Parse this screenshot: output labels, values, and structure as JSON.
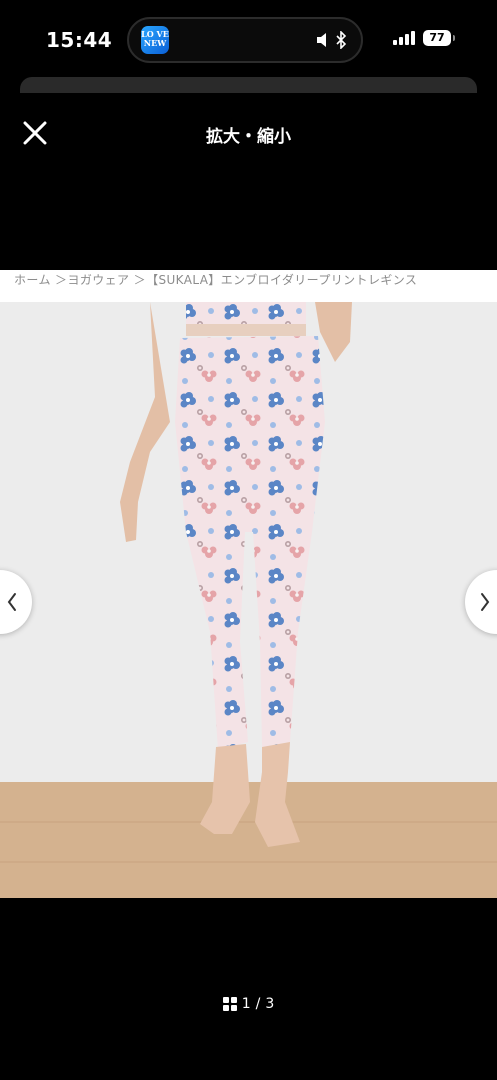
{
  "status_bar": {
    "time": "15:44",
    "app_icon_text": "LOVE\nNEW",
    "battery": "77"
  },
  "header": {
    "title": "拡大・縮小",
    "close_icon": "close-icon"
  },
  "breadcrumb": "ホーム ＞ヨガウェア ＞【SUKALA】エンブロイダリープリントレギンス",
  "pager": {
    "current": "1",
    "separator": "/",
    "total": "3"
  },
  "colors": {
    "background": "#000000",
    "photo_wall": "#e9e9e9",
    "floor": "#d4b28f",
    "legging_base": "#f4e3e6",
    "flower_blue": "#5b86c6",
    "flower_pink": "#e5a4a8"
  }
}
